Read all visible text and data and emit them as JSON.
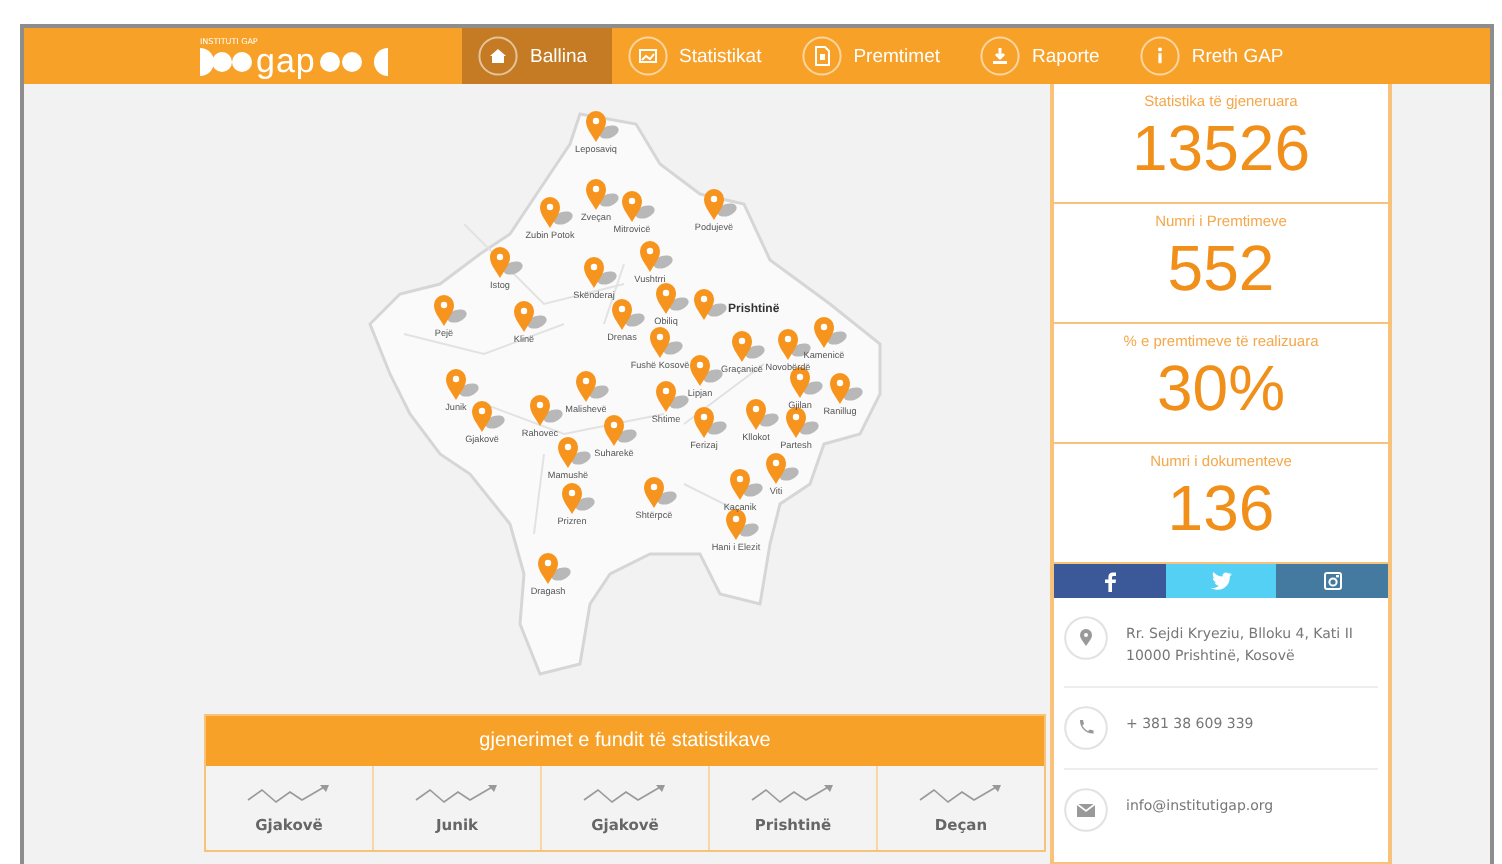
{
  "logo": {
    "tagline": "INSTITUTI GAP",
    "word": "gap"
  },
  "nav": [
    {
      "label": "Ballina",
      "selected": true
    },
    {
      "label": "Statistikat",
      "selected": false
    },
    {
      "label": "Premtimet",
      "selected": false
    },
    {
      "label": "Raporte",
      "selected": false
    },
    {
      "label": "Rreth GAP",
      "selected": false
    }
  ],
  "map": {
    "towns": [
      {
        "name": "Leposaviq",
        "capital": false
      },
      {
        "name": "Zveçan",
        "capital": false
      },
      {
        "name": "Mitrovicë",
        "capital": false
      },
      {
        "name": "Zubin Potok",
        "capital": false
      },
      {
        "name": "Podujevë",
        "capital": false
      },
      {
        "name": "Vushtrri",
        "capital": false
      },
      {
        "name": "Istog",
        "capital": false
      },
      {
        "name": "Skënderaj",
        "capital": false
      },
      {
        "name": "Obiliq",
        "capital": false
      },
      {
        "name": "Prishtinë",
        "capital": true
      },
      {
        "name": "Pejë",
        "capital": false
      },
      {
        "name": "Klinë",
        "capital": false
      },
      {
        "name": "Drenas",
        "capital": false
      },
      {
        "name": "Fushë Kosovë",
        "capital": false
      },
      {
        "name": "Graçanicë",
        "capital": false
      },
      {
        "name": "Novobërdë",
        "capital": false
      },
      {
        "name": "Kamenicë",
        "capital": false
      },
      {
        "name": "Lipjan",
        "capital": false
      },
      {
        "name": "Junik",
        "capital": false
      },
      {
        "name": "Gjakovë",
        "capital": false
      },
      {
        "name": "Rahovec",
        "capital": false
      },
      {
        "name": "Malishevë",
        "capital": false
      },
      {
        "name": "Shtime",
        "capital": false
      },
      {
        "name": "Ferizaj",
        "capital": false
      },
      {
        "name": "Suharekë",
        "capital": false
      },
      {
        "name": "Gjilan",
        "capital": false
      },
      {
        "name": "Ranillug",
        "capital": false
      },
      {
        "name": "Kllokot",
        "capital": false
      },
      {
        "name": "Partesh",
        "capital": false
      },
      {
        "name": "Viti",
        "capital": false
      },
      {
        "name": "Mamushë",
        "capital": false
      },
      {
        "name": "Prizren",
        "capital": false
      },
      {
        "name": "Shtërpcë",
        "capital": false
      },
      {
        "name": "Kaçanik",
        "capital": false
      },
      {
        "name": "Hani i Elezit",
        "capital": false
      },
      {
        "name": "Dragash",
        "capital": false
      }
    ]
  },
  "latest": {
    "title": "gjenerimet e fundit të statistikave",
    "items": [
      "Gjakovë",
      "Junik",
      "Gjakovë",
      "Prishtinë",
      "Deçan"
    ]
  },
  "stats": [
    {
      "label": "Statistika të gjeneruara",
      "value": "13526"
    },
    {
      "label": "Numri i Premtimeve",
      "value": "552"
    },
    {
      "label": "% e premtimeve të realizuara",
      "value": "30%"
    },
    {
      "label": "Numri i dokumenteve",
      "value": "136"
    }
  ],
  "social": [
    {
      "kind": "facebook",
      "color": "#3b5998"
    },
    {
      "kind": "twitter",
      "color": "#55d0f5"
    },
    {
      "kind": "instagram",
      "color": "#457aa0"
    }
  ],
  "contacts": [
    {
      "kind": "address",
      "text": "Rr. Sejdi Kryeziu, Blloku 4, Kati II 10000 Prishtinë, Kosovë"
    },
    {
      "kind": "phone",
      "text": "+ 381 38 609 339"
    },
    {
      "kind": "email",
      "text": "info@institutigap.org"
    }
  ]
}
